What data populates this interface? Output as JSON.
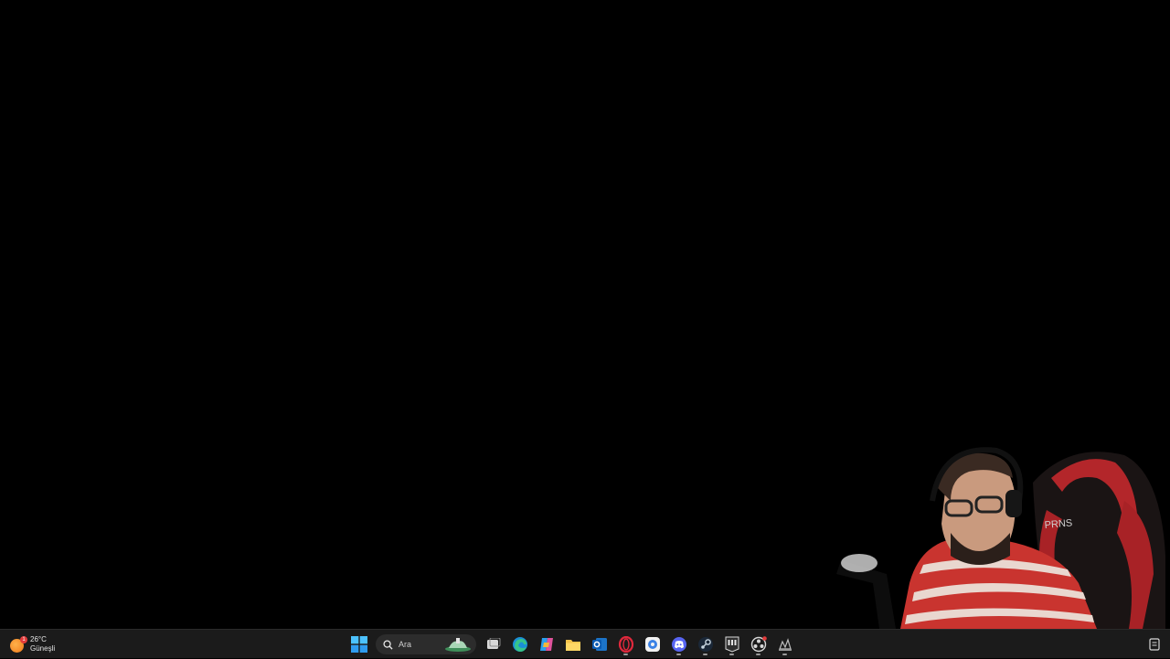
{
  "weather": {
    "temperature": "26°C",
    "condition": "Güneşli",
    "badge": "1"
  },
  "taskbar": {
    "search_placeholder": "Ara",
    "apps": [
      {
        "name": "start-button"
      },
      {
        "name": "task-view-button"
      },
      {
        "name": "edge-button"
      },
      {
        "name": "copilot-button"
      },
      {
        "name": "file-explorer-button"
      },
      {
        "name": "outlook-button"
      },
      {
        "name": "opera-gx-button"
      },
      {
        "name": "chat-app-button"
      },
      {
        "name": "discord-button"
      },
      {
        "name": "steam-button"
      },
      {
        "name": "epic-games-button"
      },
      {
        "name": "obs-button"
      },
      {
        "name": "misc-app-button"
      }
    ]
  },
  "colors": {
    "desktop": "#000000",
    "taskbar": "#1b1b1b",
    "accent": "#0078d4"
  }
}
